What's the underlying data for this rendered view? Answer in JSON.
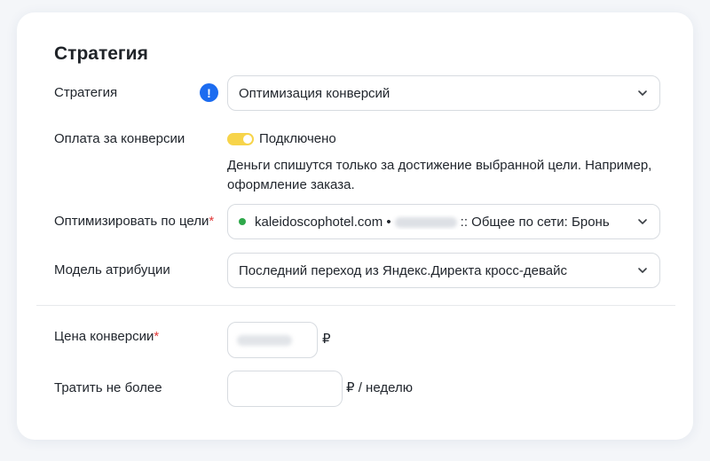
{
  "section": {
    "title": "Стратегия"
  },
  "strategy": {
    "label": "Стратегия",
    "value": "Оптимизация конверсий",
    "info_badge": "!"
  },
  "payment": {
    "label": "Оплата за конверсии",
    "toggle_state": "on",
    "toggle_label": "Подключено",
    "hint": "Деньги спишутся только за достижение выбранной цели. Например, оформление заказа."
  },
  "goal": {
    "label": "Оптимизировать по цели",
    "required_mark": "*",
    "site": "kaleidoscophotel.com •",
    "goal_name": ":: Общее по сети: Бронь",
    "status_color": "#2ea84a"
  },
  "attribution": {
    "label": "Модель атрибуции",
    "value": "Последний переход из Яндекс.Директа кросс-девайс"
  },
  "conversion_price": {
    "label": "Цена конверсии",
    "required_mark": "*",
    "currency": "₽"
  },
  "spend_limit": {
    "label": "Тратить не более",
    "unit": "₽ / неделю"
  },
  "colors": {
    "accent_blue": "#1c6cf0",
    "toggle_yellow": "#f7d44a",
    "required_red": "#e23a3a"
  }
}
